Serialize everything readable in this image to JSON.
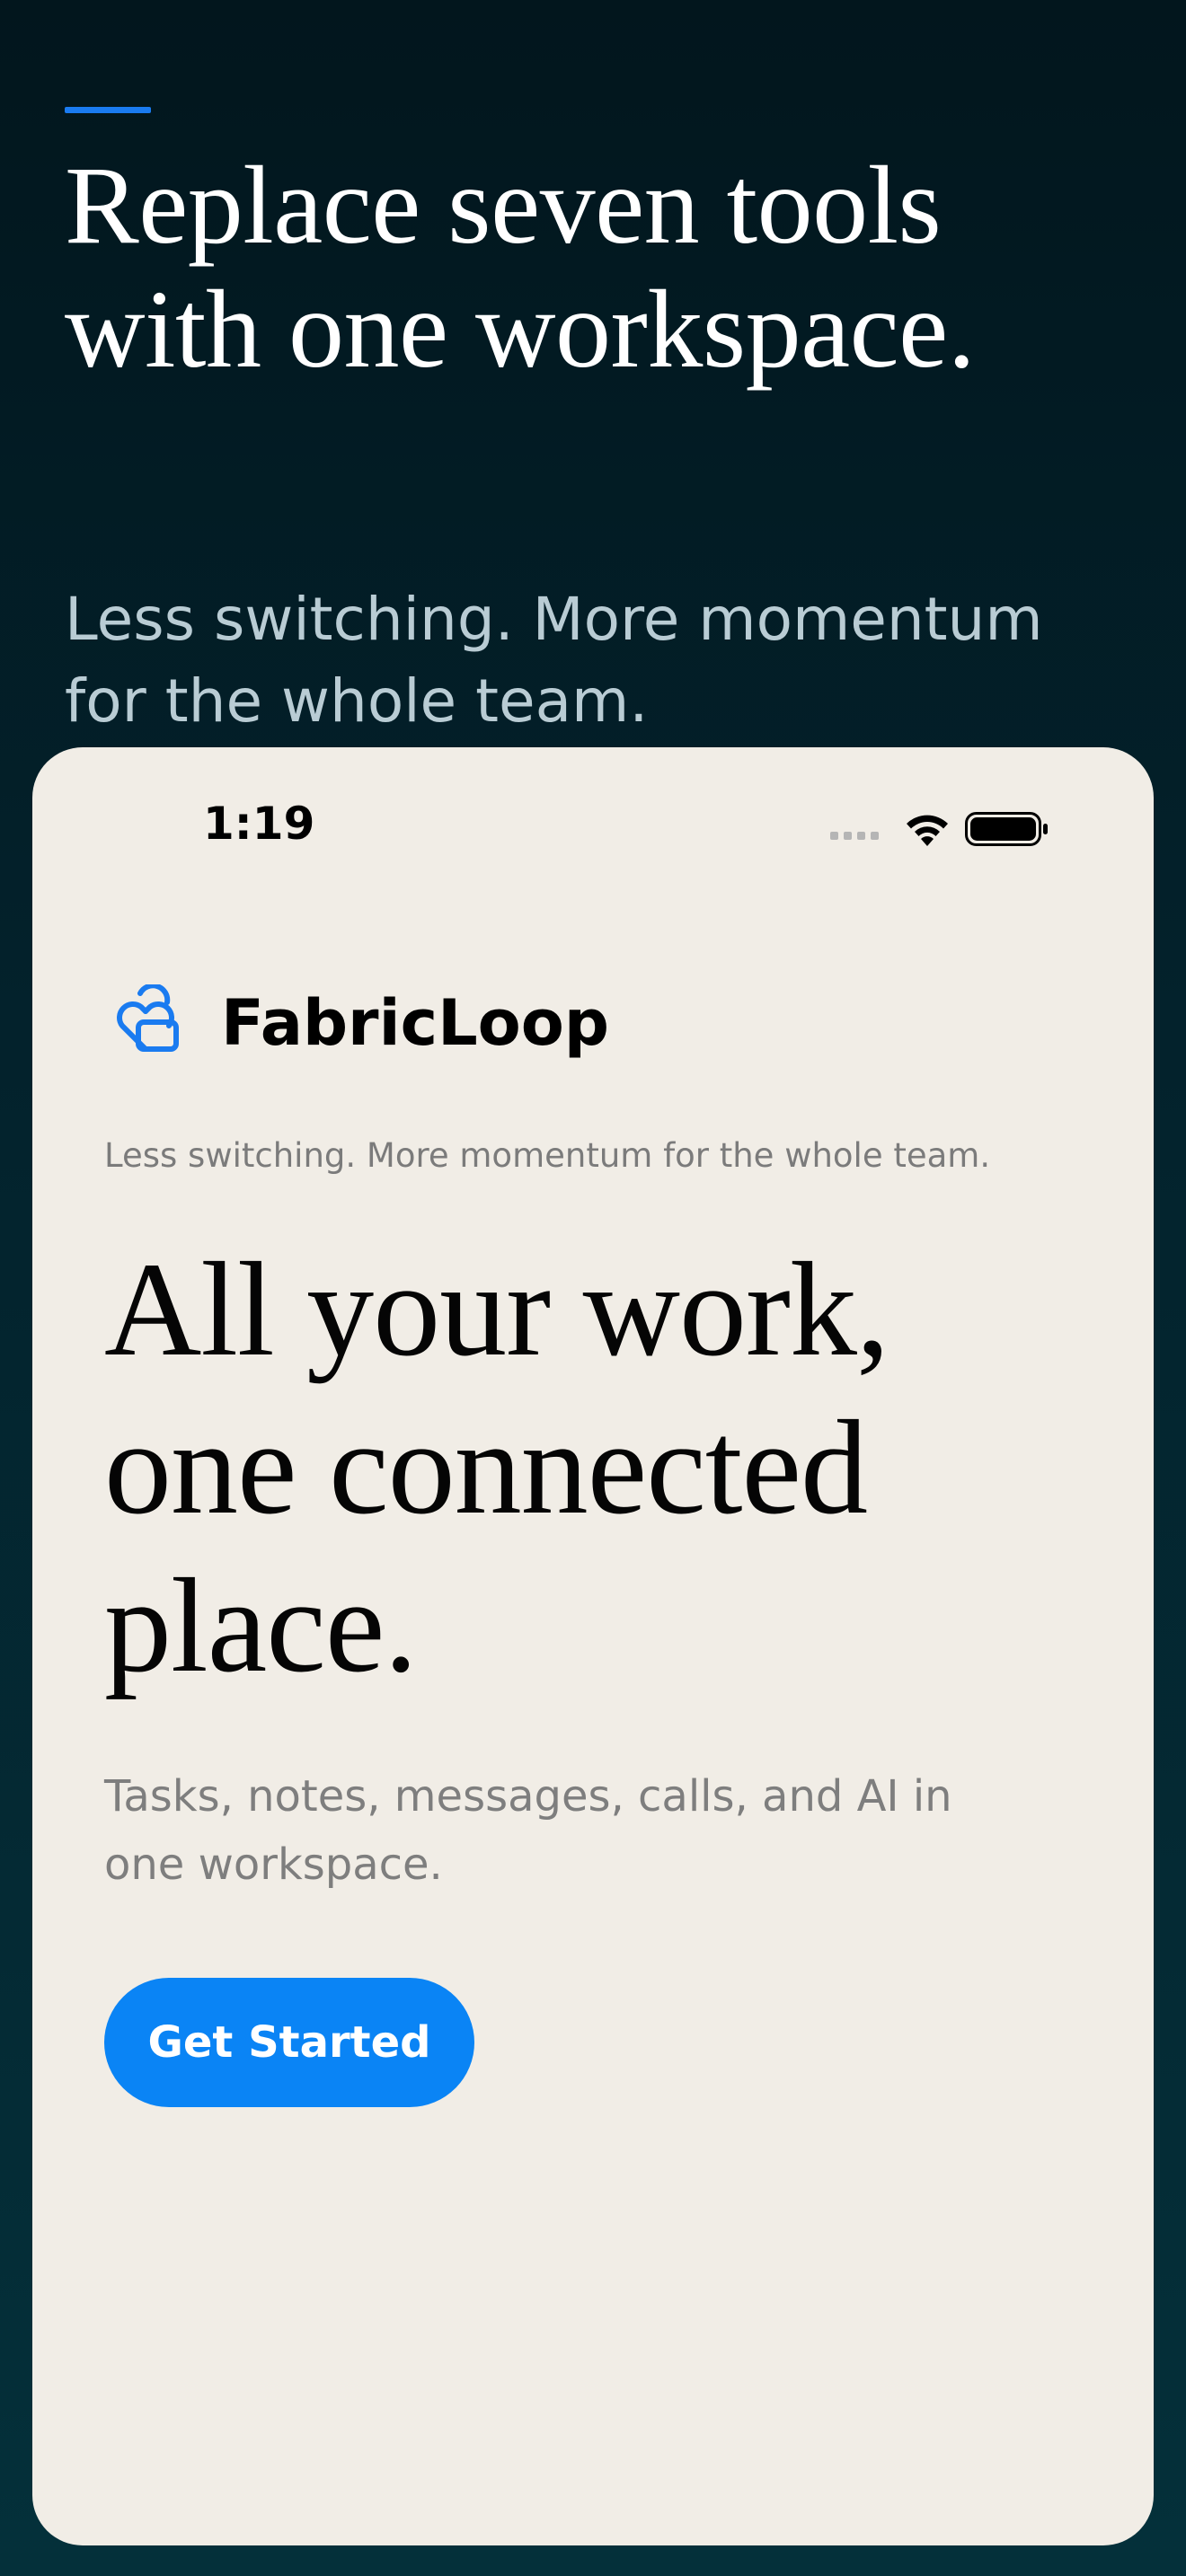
{
  "marketing": {
    "headline": "Replace seven tools with one workspace.",
    "subtitle": "Less switching. More momentum for the whole team."
  },
  "status_bar": {
    "time": "1:19",
    "icons": [
      "signal-icon",
      "wifi-icon",
      "battery-icon"
    ]
  },
  "app": {
    "brand_name": "FabricLoop",
    "brand_icon": "heart-loop-icon",
    "tagline": "Less switching. More momentum for the whole team.",
    "headline": "All your work, one connected place.",
    "description": "Tasks, notes, messages, calls, and AI in one workspace.",
    "cta_label": "Get Started"
  },
  "colors": {
    "accent": "#0a84f5",
    "background_dark": "#02161d",
    "card_background": "#f1ede6"
  }
}
